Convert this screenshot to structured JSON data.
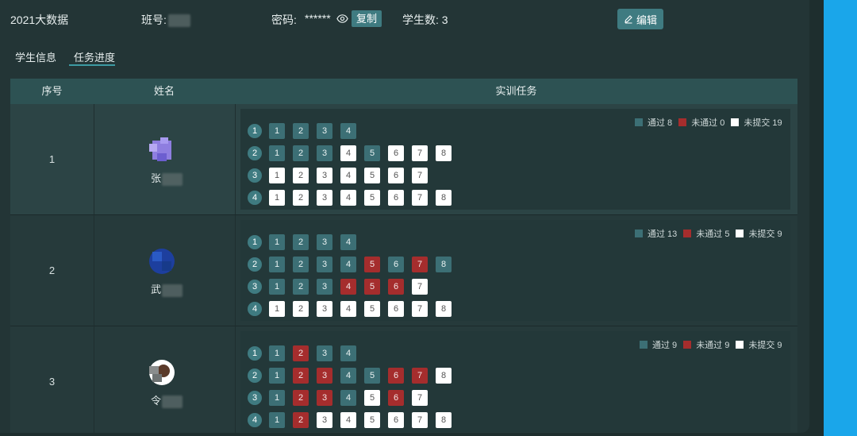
{
  "header": {
    "class_title": "2021大数据",
    "class_no_label": "班号:",
    "password_label": "密码:",
    "password_value": "******",
    "copy_label": "复制",
    "student_count_label": "学生数:",
    "student_count": "3",
    "edit_label": "编辑"
  },
  "tabs": [
    {
      "label": "学生信息",
      "active": false
    },
    {
      "label": "任务进度",
      "active": true
    }
  ],
  "table": {
    "headers": [
      "序号",
      "姓名",
      "实训任务"
    ],
    "legend_labels": {
      "pass": "通过",
      "fail": "未通过",
      "none": "未提交"
    },
    "rows": [
      {
        "index": "1",
        "name_visible": "张",
        "avatar_icon": "avatar-icon",
        "stats": {
          "pass": "8",
          "fail": "0",
          "none": "19"
        },
        "tasks": [
          {
            "num": "1",
            "items": [
              [
                "1",
                "pass"
              ],
              [
                "2",
                "pass"
              ],
              [
                "3",
                "pass"
              ],
              [
                "4",
                "pass"
              ]
            ]
          },
          {
            "num": "2",
            "items": [
              [
                "1",
                "pass"
              ],
              [
                "2",
                "pass"
              ],
              [
                "3",
                "pass"
              ],
              [
                "4",
                "none"
              ],
              [
                "5",
                "pass"
              ],
              [
                "6",
                "none"
              ],
              [
                "7",
                "none"
              ],
              [
                "8",
                "none"
              ]
            ]
          },
          {
            "num": "3",
            "items": [
              [
                "1",
                "none"
              ],
              [
                "2",
                "none"
              ],
              [
                "3",
                "none"
              ],
              [
                "4",
                "none"
              ],
              [
                "5",
                "none"
              ],
              [
                "6",
                "none"
              ],
              [
                "7",
                "none"
              ]
            ]
          },
          {
            "num": "4",
            "items": [
              [
                "1",
                "none"
              ],
              [
                "2",
                "none"
              ],
              [
                "3",
                "none"
              ],
              [
                "4",
                "none"
              ],
              [
                "5",
                "none"
              ],
              [
                "6",
                "none"
              ],
              [
                "7",
                "none"
              ],
              [
                "8",
                "none"
              ]
            ]
          }
        ]
      },
      {
        "index": "2",
        "name_visible": "武",
        "avatar_icon": "avatar-icon",
        "stats": {
          "pass": "13",
          "fail": "5",
          "none": "9"
        },
        "tasks": [
          {
            "num": "1",
            "items": [
              [
                "1",
                "pass"
              ],
              [
                "2",
                "pass"
              ],
              [
                "3",
                "pass"
              ],
              [
                "4",
                "pass"
              ]
            ]
          },
          {
            "num": "2",
            "items": [
              [
                "1",
                "pass"
              ],
              [
                "2",
                "pass"
              ],
              [
                "3",
                "pass"
              ],
              [
                "4",
                "pass"
              ],
              [
                "5",
                "fail"
              ],
              [
                "6",
                "pass"
              ],
              [
                "7",
                "fail"
              ],
              [
                "8",
                "pass"
              ]
            ]
          },
          {
            "num": "3",
            "items": [
              [
                "1",
                "pass"
              ],
              [
                "2",
                "pass"
              ],
              [
                "3",
                "pass"
              ],
              [
                "4",
                "fail"
              ],
              [
                "5",
                "fail"
              ],
              [
                "6",
                "fail"
              ],
              [
                "7",
                "none"
              ]
            ]
          },
          {
            "num": "4",
            "items": [
              [
                "1",
                "none"
              ],
              [
                "2",
                "none"
              ],
              [
                "3",
                "none"
              ],
              [
                "4",
                "none"
              ],
              [
                "5",
                "none"
              ],
              [
                "6",
                "none"
              ],
              [
                "7",
                "none"
              ],
              [
                "8",
                "none"
              ]
            ]
          }
        ]
      },
      {
        "index": "3",
        "name_visible": "令",
        "avatar_icon": "avatar-icon",
        "stats": {
          "pass": "9",
          "fail": "9",
          "none": "9"
        },
        "tasks": [
          {
            "num": "1",
            "items": [
              [
                "1",
                "pass"
              ],
              [
                "2",
                "fail"
              ],
              [
                "3",
                "pass"
              ],
              [
                "4",
                "pass"
              ]
            ]
          },
          {
            "num": "2",
            "items": [
              [
                "1",
                "pass"
              ],
              [
                "2",
                "fail"
              ],
              [
                "3",
                "fail"
              ],
              [
                "4",
                "pass"
              ],
              [
                "5",
                "pass"
              ],
              [
                "6",
                "fail"
              ],
              [
                "7",
                "fail"
              ],
              [
                "8",
                "none"
              ]
            ]
          },
          {
            "num": "3",
            "items": [
              [
                "1",
                "pass"
              ],
              [
                "2",
                "fail"
              ],
              [
                "3",
                "fail"
              ],
              [
                "4",
                "pass"
              ],
              [
                "5",
                "none"
              ],
              [
                "6",
                "fail"
              ],
              [
                "7",
                "none"
              ]
            ]
          },
          {
            "num": "4",
            "items": [
              [
                "1",
                "pass"
              ],
              [
                "2",
                "fail"
              ],
              [
                "3",
                "none"
              ],
              [
                "4",
                "none"
              ],
              [
                "5",
                "none"
              ],
              [
                "6",
                "none"
              ],
              [
                "7",
                "none"
              ],
              [
                "8",
                "none"
              ]
            ]
          }
        ]
      }
    ]
  },
  "colors": {
    "pass": "#3c6f75",
    "fail": "#a52d2d",
    "none": "#ffffff",
    "accent": "#3f7b81"
  }
}
